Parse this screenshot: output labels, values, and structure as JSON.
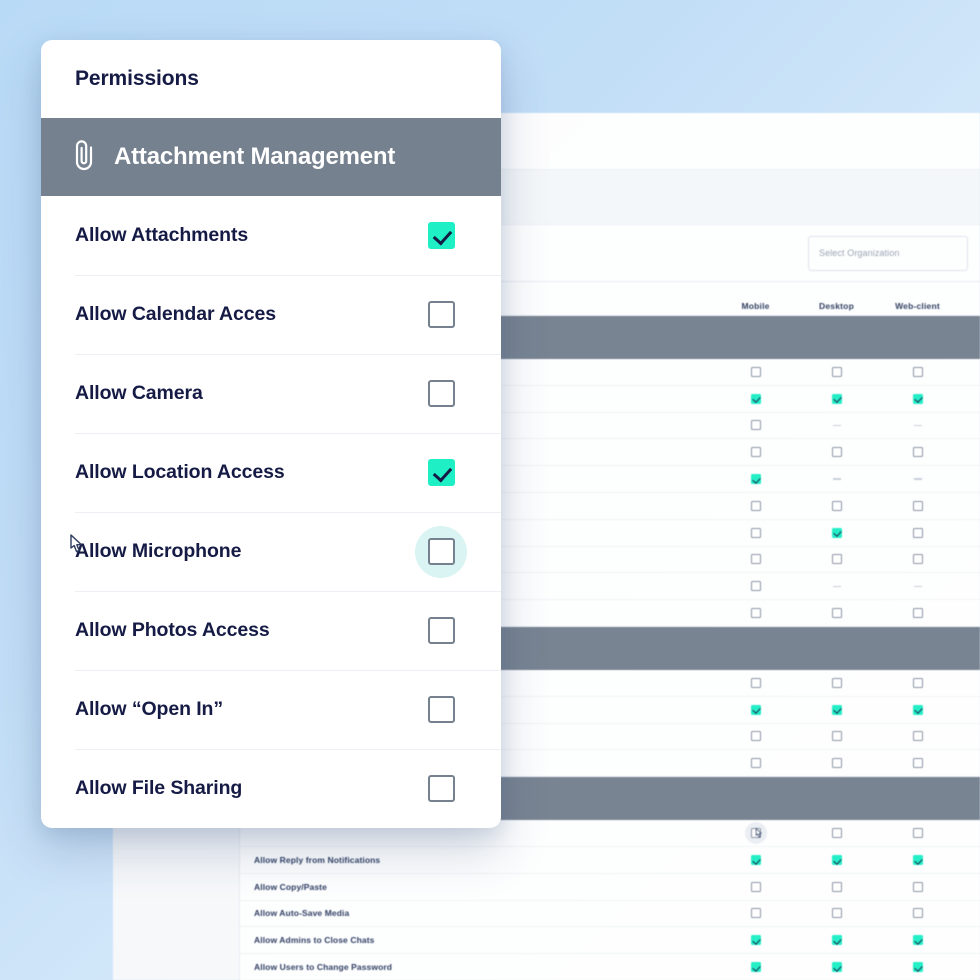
{
  "theme": {
    "background_gradient_start": "#b9daf6",
    "background_gradient_end": "#eaf3fd",
    "accent_checked": "#1eefc5",
    "slate_header": "#76818f",
    "text_navy": "#151b45",
    "hover_circle": "#d9f4f2",
    "sidebar_bg": "#f7f8fa"
  },
  "card": {
    "title": "Permissions",
    "section": {
      "icon": "paperclip-icon",
      "label": "Attachment Management"
    },
    "rows": [
      {
        "label": "Allow Attachments",
        "checked": true,
        "hovered": false,
        "cursor": false
      },
      {
        "label": "Allow Calendar Acces",
        "checked": false,
        "hovered": false,
        "cursor": false
      },
      {
        "label": "Allow Camera",
        "checked": false,
        "hovered": false,
        "cursor": false
      },
      {
        "label": "Allow Location Access",
        "checked": true,
        "hovered": false,
        "cursor": false
      },
      {
        "label": "Allow Microphone",
        "checked": false,
        "hovered": true,
        "cursor": true
      },
      {
        "label": "Allow Photos Access",
        "checked": false,
        "hovered": false,
        "cursor": false
      },
      {
        "label": "Allow “Open In”",
        "checked": false,
        "hovered": false,
        "cursor": false
      },
      {
        "label": "Allow File Sharing",
        "checked": false,
        "hovered": false,
        "cursor": false
      }
    ]
  },
  "background_app": {
    "organization_select": {
      "placeholder": "Select Organization",
      "value": ""
    },
    "columns": [
      "Mobile",
      "Desktop",
      "Web-client"
    ],
    "blocks": [
      {
        "type": "group",
        "label": ""
      },
      {
        "type": "rows",
        "rows": [
          {
            "label": "",
            "states": [
              "off",
              "off",
              "off"
            ]
          },
          {
            "label": "",
            "states": [
              "on",
              "on",
              "on"
            ]
          },
          {
            "label": "",
            "states": [
              "off",
              "dash",
              "dash"
            ]
          },
          {
            "label": "",
            "states": [
              "off",
              "off",
              "off"
            ]
          },
          {
            "label": "",
            "states": [
              "on",
              "dash",
              "dash"
            ]
          },
          {
            "label": "",
            "states": [
              "off",
              "off",
              "off"
            ]
          },
          {
            "label": "",
            "states": [
              "off",
              "on",
              "off"
            ]
          },
          {
            "label": "",
            "states": [
              "off",
              "off",
              "off"
            ]
          },
          {
            "label": "",
            "states": [
              "off",
              "dash",
              "dash"
            ]
          },
          {
            "label": "",
            "states": [
              "off",
              "off",
              "off"
            ]
          }
        ]
      },
      {
        "type": "group",
        "label": ""
      },
      {
        "type": "rows",
        "rows": [
          {
            "label": "",
            "states": [
              "off",
              "off",
              "off"
            ]
          },
          {
            "label": "",
            "states": [
              "on",
              "on",
              "on"
            ]
          },
          {
            "label": "",
            "states": [
              "off",
              "off",
              "off"
            ]
          },
          {
            "label": "",
            "states": [
              "off",
              "off",
              "off"
            ]
          }
        ]
      },
      {
        "type": "group",
        "label": ""
      },
      {
        "type": "rows",
        "rows": [
          {
            "label": "",
            "states": [
              "hover-off",
              "off",
              "off"
            ]
          },
          {
            "label": "Allow Reply from Notifications",
            "states": [
              "on",
              "on",
              "on"
            ]
          },
          {
            "label": "Allow Copy/Paste",
            "states": [
              "off",
              "off",
              "off"
            ]
          },
          {
            "label": "Allow Auto-Save Media",
            "states": [
              "off",
              "off",
              "off"
            ]
          },
          {
            "label": "Allow Admins to Close Chats",
            "states": [
              "on",
              "on",
              "on"
            ]
          },
          {
            "label": "Allow Users to Change Password",
            "states": [
              "on",
              "on",
              "on"
            ]
          }
        ]
      }
    ]
  }
}
